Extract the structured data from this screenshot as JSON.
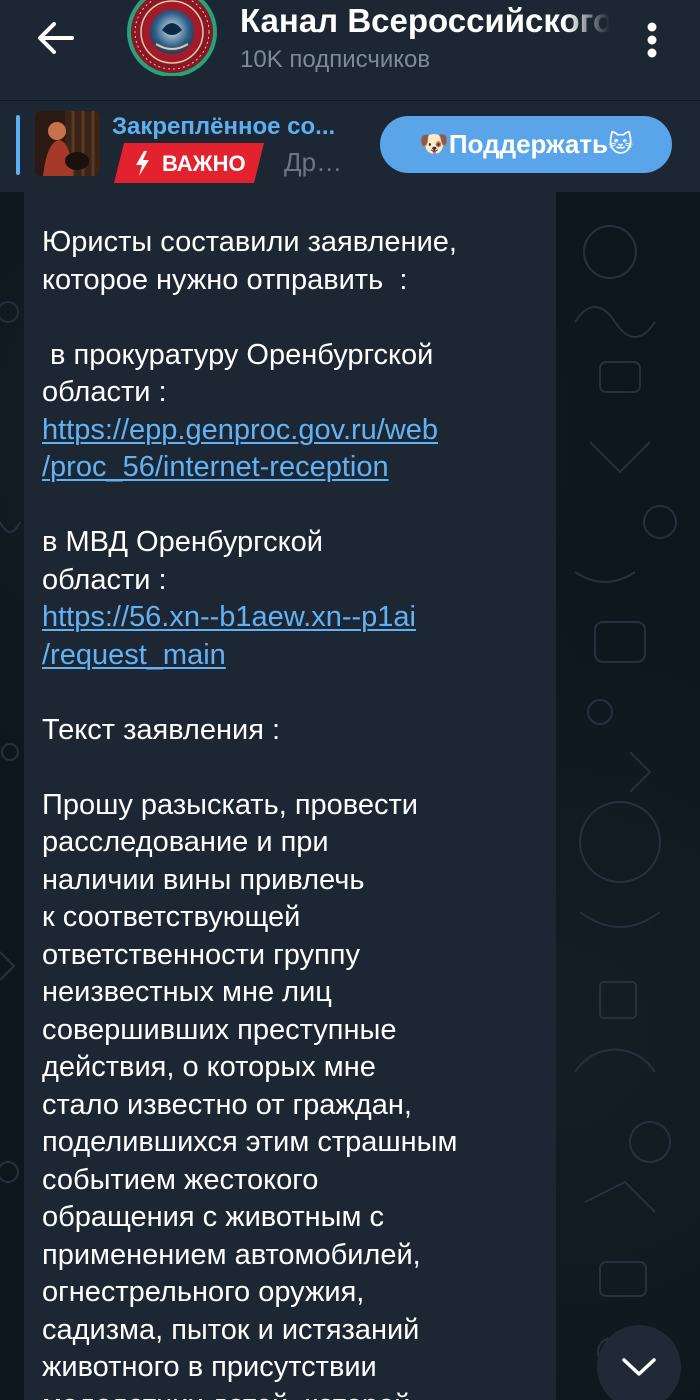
{
  "header": {
    "title": "Канал Всероссийского",
    "subscribers": "10K подписчиков"
  },
  "pinned": {
    "title": "Закреплённое со...",
    "badge": "ВАЖНО",
    "rest": "Др…",
    "support": {
      "label": "Поддержать",
      "emoji_left": "🐶",
      "emoji_right": "🐱"
    }
  },
  "message": {
    "lines": [
      {
        "text": "Юристы составили заявление,"
      },
      {
        "text": "которое нужно отправить  :"
      },
      {
        "text": ""
      },
      {
        "text": " в прокуратуру Оренбургской"
      },
      {
        "text": "области :"
      },
      {
        "text": "https://epp.genproc.gov.ru/web",
        "link": true
      },
      {
        "text": "/proc_56/internet-reception",
        "link": true
      },
      {
        "text": ""
      },
      {
        "text": "в МВД Оренбургской"
      },
      {
        "text": "области :"
      },
      {
        "text": "https://56.xn--b1aew.xn--p1ai",
        "link": true
      },
      {
        "text": "/request_main",
        "link": true
      },
      {
        "text": ""
      },
      {
        "text": "Текст заявления :"
      },
      {
        "text": ""
      },
      {
        "text": "Прошу разыскать, провести"
      },
      {
        "text": "расследование и при"
      },
      {
        "text": "наличии вины привлечь"
      },
      {
        "text": "к соответствующей"
      },
      {
        "text": "ответственности группу"
      },
      {
        "text": "неизвестных мне лиц"
      },
      {
        "text": "совершивших преступные"
      },
      {
        "text": "действия, о которых мне"
      },
      {
        "text": "стало известно от граждан,"
      },
      {
        "text": "поделившихся этим страшным"
      },
      {
        "text": "событием жестокого"
      },
      {
        "text": "обращения с животным с"
      },
      {
        "text": "применением автомобилей,"
      },
      {
        "text": "огнестрельного оружия,"
      },
      {
        "text": "садизма, пыток и истязаний"
      },
      {
        "text": "животного в присутствии"
      },
      {
        "text": "малолетних детей, которой"
      }
    ]
  },
  "colors": {
    "header_bg": "#1c2733",
    "bubble_bg": "#1d2733",
    "link": "#62b2f6",
    "accent": "#5aa5ea",
    "badge_red": "#e2232f"
  },
  "icons": {
    "back": "arrow-left-icon",
    "menu": "kebab-menu-icon",
    "scroll": "chevron-down-icon",
    "bolt": "lightning-icon"
  }
}
